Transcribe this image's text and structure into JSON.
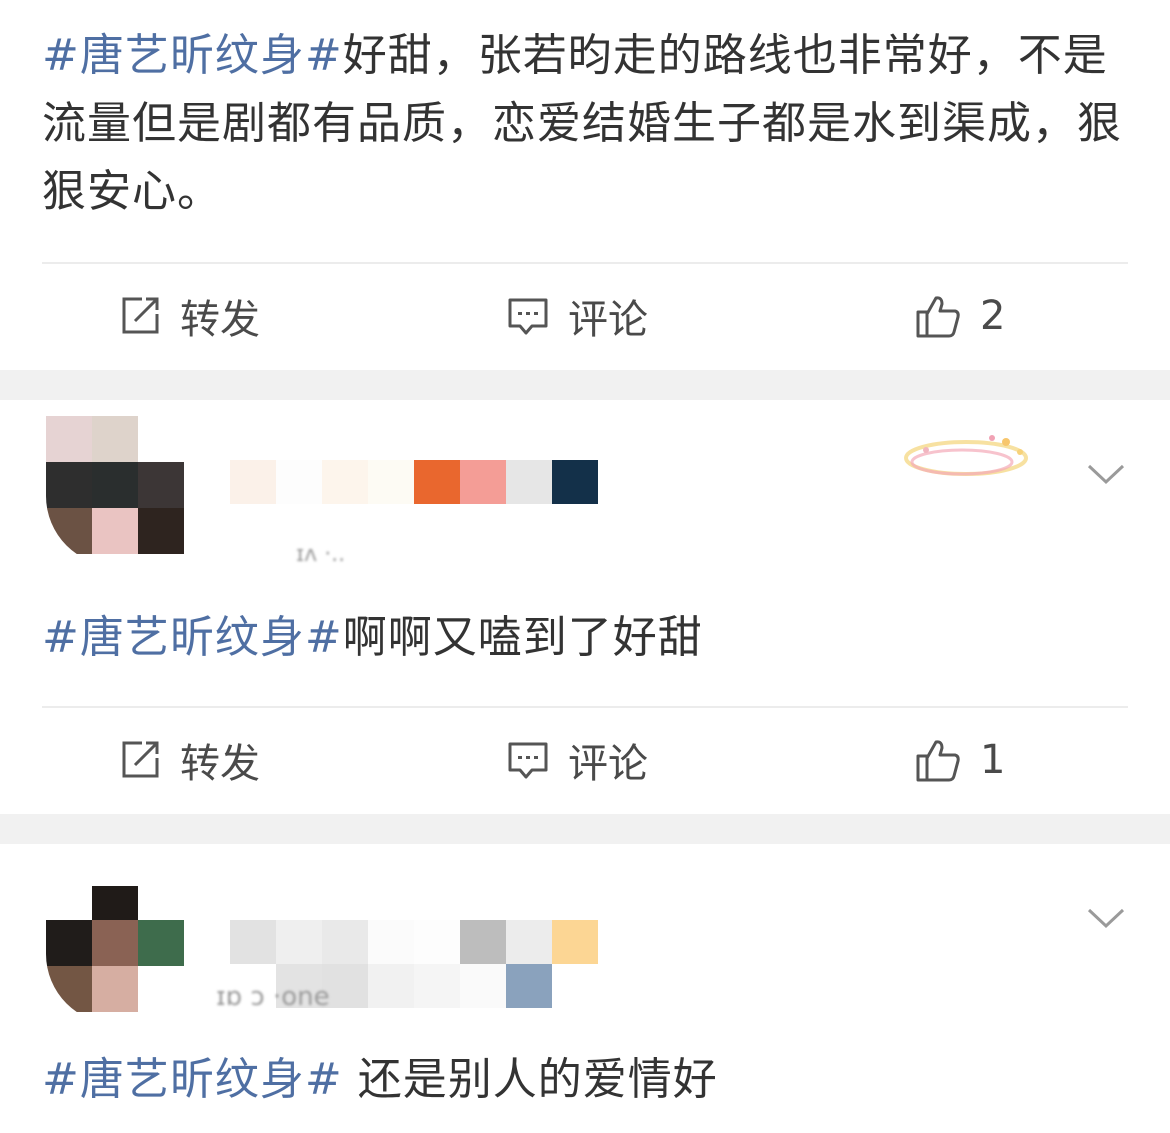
{
  "posts": [
    {
      "topic": "#唐艺昕纹身#",
      "text": "好甜，张若昀走的路线也非常好，不是流量但是剧都有品质，恋爱结婚生子都是水到渠成，狠狠安心。",
      "actions": {
        "repost": "转发",
        "comment": "评论",
        "like_count": "2"
      }
    },
    {
      "user_sub": "ɪʌ ·..",
      "topic": "#唐艺昕纹身#",
      "text": "啊啊又嗑到了好甜",
      "actions": {
        "repost": "转发",
        "comment": "评论",
        "like_count": "1"
      }
    },
    {
      "user_sub": "ɪɒ  ɔ          ·one",
      "topic": "#唐艺昕纹身#",
      "text": " 还是别人的爱情好"
    }
  ],
  "icons": [
    "repost-icon",
    "comment-icon",
    "like-icon",
    "chevron-down-icon"
  ],
  "colors": {
    "topic": "#4f6fa3",
    "text": "#333333",
    "separator": "#f1f1f1"
  }
}
